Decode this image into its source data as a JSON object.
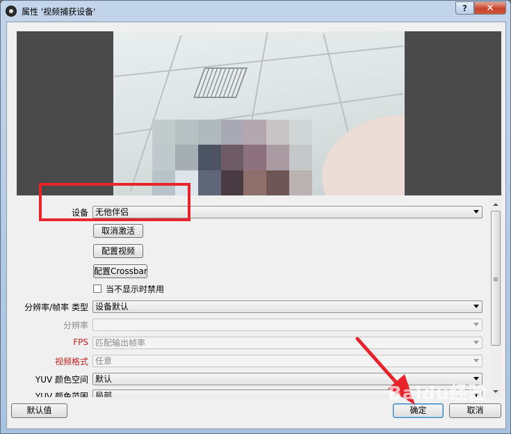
{
  "window": {
    "title": "属性 '视频捕获设备'",
    "help_label": "?",
    "close_label": "✕"
  },
  "form": {
    "device_label": "设备",
    "device_value": "无他伴侣",
    "deactivate_button": "取消激活",
    "configure_video_button": "配置视频",
    "configure_crossbar_button": "配置Crossbar",
    "disable_when_hidden_label": "当不显示时禁用",
    "resolution_type_label": "分辨率/帧率 类型",
    "resolution_type_value": "设备默认",
    "resolution_label": "分辨率",
    "resolution_value": "",
    "fps_label": "FPS",
    "fps_value": "匹配输出帧率",
    "video_format_label": "视频格式",
    "video_format_value": "任意",
    "yuv_color_space_label": "YUV 颜色空间",
    "yuv_color_space_value": "默认",
    "yuv_color_range_label": "YUV 颜色范围",
    "yuv_color_range_value": "局部"
  },
  "footer": {
    "defaults_button": "默认值",
    "ok_button": "确定",
    "cancel_button": "取消"
  },
  "watermark": "Baidu经验",
  "colors": {
    "annotation_red": "#e8232c",
    "required_label_red": "#c81e1e"
  }
}
